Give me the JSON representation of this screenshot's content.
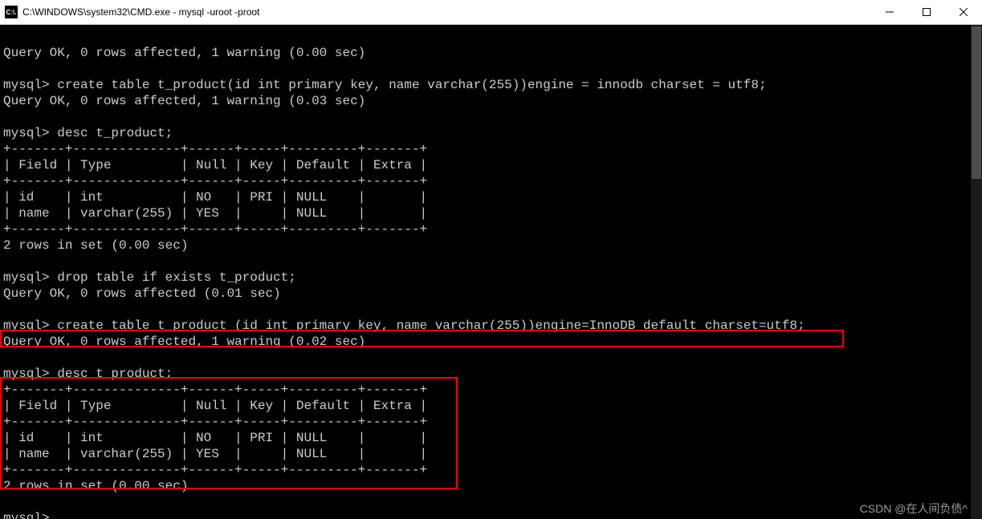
{
  "window": {
    "icon_text": "C:\\.",
    "title": "C:\\WINDOWS\\system32\\CMD.exe - mysql  -uroot -proot"
  },
  "lines": {
    "l0": "Query OK, 0 rows affected, 1 warning (0.00 sec)",
    "l1": "",
    "l2": "mysql> create table t_product(id int primary key, name varchar(255))engine = innodb charset = utf8;",
    "l3": "Query OK, 0 rows affected, 1 warning (0.03 sec)",
    "l4": "",
    "l5": "mysql> desc t_product;",
    "l6": "+-------+--------------+------+-----+---------+-------+",
    "l7": "| Field | Type         | Null | Key | Default | Extra |",
    "l8": "+-------+--------------+------+-----+---------+-------+",
    "l9": "| id    | int          | NO   | PRI | NULL    |       |",
    "l10": "| name  | varchar(255) | YES  |     | NULL    |       |",
    "l11": "+-------+--------------+------+-----+---------+-------+",
    "l12": "2 rows in set (0.00 sec)",
    "l13": "",
    "l14": "mysql> drop table if exists t_product;",
    "l15": "Query OK, 0 rows affected (0.01 sec)",
    "l16": "",
    "l17": "mysql> create table t_product (id int primary key, name varchar(255))engine=InnoDB default charset=utf8;",
    "l18": "Query OK, 0 rows affected, 1 warning (0.02 sec)",
    "l19": "",
    "l20": "mysql> desc t_product;",
    "l21": "+-------+--------------+------+-----+---------+-------+",
    "l22": "| Field | Type         | Null | Key | Default | Extra |",
    "l23": "+-------+--------------+------+-----+---------+-------+",
    "l24": "| id    | int          | NO   | PRI | NULL    |       |",
    "l25": "| name  | varchar(255) | YES  |     | NULL    |       |",
    "l26": "+-------+--------------+------+-----+---------+-------+",
    "l27": "2 rows in set (0.00 sec)",
    "l28": "",
    "l29": "mysql>"
  },
  "watermark": "CSDN @在人间负债^"
}
